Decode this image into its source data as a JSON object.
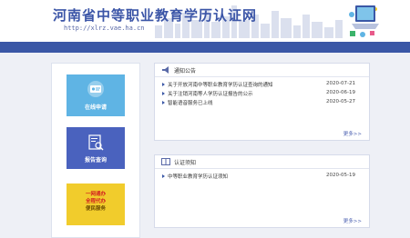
{
  "header": {
    "title": "河南省中等职业教育学历认证网",
    "url": "http://xlrz.vae.ha.cn"
  },
  "tiles": {
    "online_apply": "在线申请",
    "report_query": "报告查询",
    "notice_line1": "一网通办",
    "notice_line2": "全程代办",
    "notice_line3": "便民服务"
  },
  "notices": {
    "title": "通知公告",
    "items": [
      {
        "text": "关于开放河南中等职业教育学历认证查询的通知",
        "date": "2020-07-21"
      },
      {
        "text": "关于注销河南等人学历认证报告的公示",
        "date": "2020-06-19"
      },
      {
        "text": "智能语音服务已上线",
        "date": "2020-05-27"
      }
    ],
    "more": "更多>>"
  },
  "guide": {
    "title": "认证须知",
    "items": [
      {
        "text": "中等职业教育学历认证须知",
        "date": "2020-05-19"
      }
    ],
    "more": "更多>>"
  },
  "colors": {
    "navbar": "#3a57a6",
    "title": "#3b55a7",
    "tile_blue_light": "#5fb4e4",
    "tile_blue_dark": "#4a62be",
    "tile_yellow": "#f1cc2c"
  }
}
